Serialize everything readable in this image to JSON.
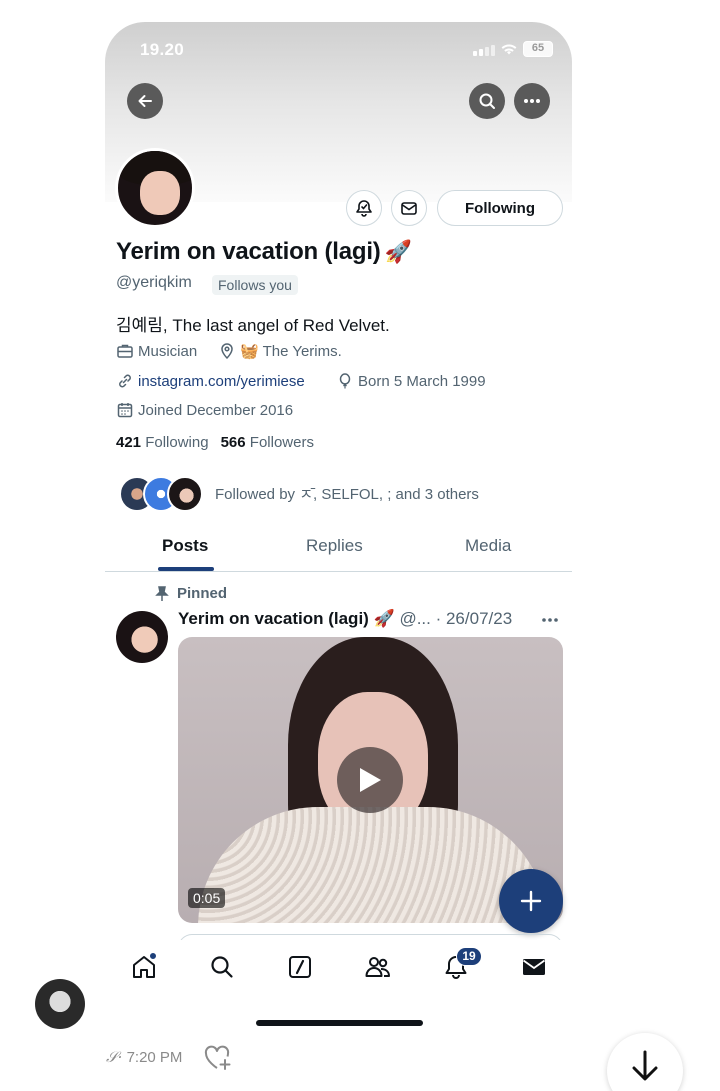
{
  "status_bar": {
    "time": "19.20",
    "battery": "65"
  },
  "profile": {
    "name": "Yerim on vacation (lagi)",
    "name_emoji": "🚀",
    "handle": "@yeriqkim",
    "follows_you": "Follows you",
    "bio": "김예림, The last angel of Red Velvet.",
    "following_button": "Following",
    "meta": {
      "job": "Musician",
      "location": "🧺 The Yerims.",
      "url": "instagram.com/yerimiese",
      "born": "Born 5 March 1999",
      "joined": "Joined December 2016"
    },
    "stats": {
      "following_count": "421",
      "following_label": "Following",
      "followers_count": "566",
      "followers_label": "Followers"
    },
    "followed_by": "Followed by ㅈ̄, SELFOL, ; and 3 others"
  },
  "tabs": [
    {
      "label": "Posts"
    },
    {
      "label": "Replies"
    },
    {
      "label": "Media"
    }
  ],
  "post": {
    "pinned_label": "Pinned",
    "author": "Yerim on vacation (lagi) 🚀",
    "rest": " @... · 26/07/23",
    "video_duration": "0:05"
  },
  "nav": {
    "notification_badge": "19"
  },
  "chat": {
    "check_mark": "𝒮·",
    "time": "7:20 PM"
  },
  "colors": {
    "accent": "#1d3f7a",
    "text_primary": "#0f1419",
    "text_secondary": "#536471",
    "border": "#cfd9de"
  }
}
